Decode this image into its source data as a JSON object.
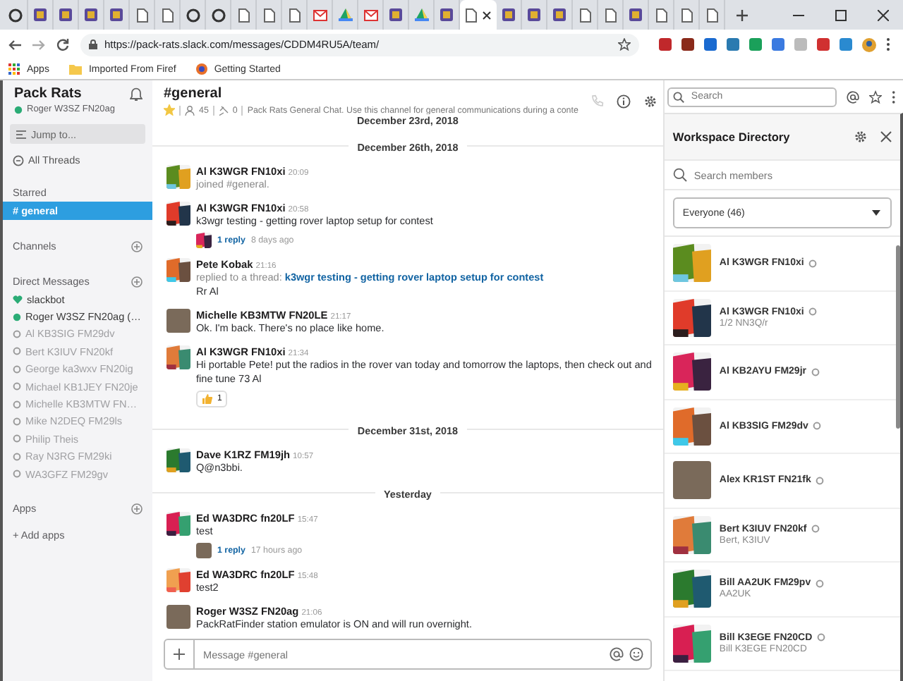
{
  "browser": {
    "tabs": [
      {
        "kind": "round",
        "selected": false
      },
      {
        "kind": "app",
        "selected": false
      },
      {
        "kind": "app",
        "selected": false
      },
      {
        "kind": "app",
        "selected": false
      },
      {
        "kind": "app",
        "selected": false
      },
      {
        "kind": "page",
        "selected": false
      },
      {
        "kind": "page",
        "selected": false
      },
      {
        "kind": "round",
        "selected": false
      },
      {
        "kind": "round",
        "selected": false
      },
      {
        "kind": "page",
        "selected": false
      },
      {
        "kind": "page",
        "selected": false
      },
      {
        "kind": "page",
        "selected": false
      },
      {
        "kind": "mail",
        "selected": false
      },
      {
        "kind": "drive",
        "selected": false
      },
      {
        "kind": "mail",
        "selected": false
      },
      {
        "kind": "app",
        "selected": false
      },
      {
        "kind": "drive",
        "selected": false
      },
      {
        "kind": "app",
        "selected": false
      },
      {
        "kind": "page",
        "selected": true
      },
      {
        "kind": "app",
        "selected": false
      },
      {
        "kind": "app",
        "selected": false
      },
      {
        "kind": "app",
        "selected": false
      },
      {
        "kind": "page",
        "selected": false
      },
      {
        "kind": "page",
        "selected": false
      },
      {
        "kind": "app",
        "selected": false
      },
      {
        "kind": "page",
        "selected": false
      },
      {
        "kind": "page",
        "selected": false
      },
      {
        "kind": "page",
        "selected": false
      }
    ],
    "url": "https://pack-rats.slack.com/messages/CDDM4RU5A/team/",
    "bookmarks": [
      "Apps",
      "Imported From Firef",
      "Getting Started"
    ]
  },
  "sidebar": {
    "workspace": "Pack Rats",
    "user": "Roger W3SZ FN20ag",
    "jump": "Jump to...",
    "all_threads": "All Threads",
    "sections": [
      {
        "title": "Starred",
        "add": false,
        "items": [
          {
            "label": "# general",
            "selected": true,
            "kind": "channel"
          }
        ]
      },
      {
        "title": "Channels",
        "add": true
      },
      {
        "title": "Direct Messages",
        "add": true,
        "items": [
          {
            "label": "slackbot",
            "kind": "bot",
            "online": true,
            "selected": false
          },
          {
            "label": "Roger W3SZ FN20ag (…",
            "kind": "person",
            "online": true,
            "selected": false
          },
          {
            "label": "Al KB3SIG FM29dv",
            "kind": "person",
            "online": false,
            "selected": false
          },
          {
            "label": "Bert K3IUV FN20kf",
            "kind": "person",
            "online": false,
            "selected": false
          },
          {
            "label": "George ka3wxv FN20ig",
            "kind": "person",
            "online": false,
            "selected": false
          },
          {
            "label": "Michael KB1JEY FN20je",
            "kind": "person",
            "online": false,
            "selected": false
          },
          {
            "label": "Michelle KB3MTW FN…",
            "kind": "person",
            "online": false,
            "selected": false
          },
          {
            "label": "Mike N2DEQ FM29ls",
            "kind": "person",
            "online": false,
            "selected": false
          },
          {
            "label": "Philip Theis",
            "kind": "person",
            "online": false,
            "selected": false
          },
          {
            "label": "Ray N3RG FM29ki",
            "kind": "person",
            "online": false,
            "selected": false
          },
          {
            "label": "WA3GFZ FM29gv",
            "kind": "person",
            "online": false,
            "selected": false
          }
        ]
      },
      {
        "title": "Apps",
        "add": true
      }
    ],
    "add_apps": "+ Add apps"
  },
  "channel": {
    "name": "#general",
    "starred": true,
    "members": "45",
    "pins": "0",
    "topic": "Pack Rats General Chat.  Use this channel for general communications during a conte"
  },
  "search": {
    "placeholder": "Search"
  },
  "messages": [
    {
      "kind": "date",
      "text": "December 23rd, 2018"
    },
    {
      "kind": "date",
      "text": "December 26th, 2018"
    },
    {
      "kind": "event",
      "author": "Al K3WGR FN10xi",
      "time": "20:09",
      "avatar": {
        "kind": "identicon"
      },
      "text": "joined #general."
    },
    {
      "kind": "message",
      "author": "Al K3WGR FN10xi",
      "time": "20:58",
      "avatar": {
        "kind": "identicon"
      },
      "text": "k3wgr testing - getting rover laptop setup for contest",
      "replies": {
        "count": "1 reply",
        "when": "8 days ago",
        "avatar": {
          "kind": "identicon"
        }
      }
    },
    {
      "kind": "message",
      "author": "Pete Kobak",
      "time": "21:16",
      "avatar": {
        "kind": "identicon"
      },
      "thread": {
        "prefix": "replied to a thread:",
        "link": "k3wgr testing - getting rover laptop setup for contest"
      },
      "text": "Rr Al"
    },
    {
      "kind": "message",
      "author": "Michelle KB3MTW FN20LE",
      "time": "21:17",
      "avatar": {
        "kind": "photo"
      },
      "text": "Ok. I'm back. There's no place like home."
    },
    {
      "kind": "message",
      "author": "Al K3WGR FN10xi",
      "time": "21:34",
      "avatar": {
        "kind": "identicon"
      },
      "text": "Hi portable Pete! put the radios in the rover van today and tomorrow the laptops, then check out and  fine tune 73  Al",
      "reaction": {
        "count": "1"
      }
    },
    {
      "kind": "date",
      "text": "December 31st, 2018"
    },
    {
      "kind": "message",
      "author": "Dave K1RZ FM19jh",
      "time": "10:57",
      "avatar": {
        "kind": "identicon"
      },
      "text": "Q@n3bbi."
    },
    {
      "kind": "date",
      "text": "Yesterday"
    },
    {
      "kind": "message",
      "author": "Ed WA3DRC fn20LF",
      "time": "15:47",
      "avatar": {
        "kind": "identicon"
      },
      "text": "test",
      "replies": {
        "count": "1 reply",
        "when": "17 hours ago",
        "avatar": {
          "kind": "photo"
        }
      }
    },
    {
      "kind": "message",
      "author": "Ed WA3DRC fn20LF",
      "time": "15:48",
      "avatar": {
        "kind": "identicon"
      },
      "text": "test2"
    },
    {
      "kind": "message",
      "author": "Roger W3SZ FN20ag",
      "time": "21:06",
      "avatar": {
        "kind": "photo"
      },
      "text": "PackRatFinder station emulator is ON and will run overnight."
    }
  ],
  "composer": {
    "placeholder": "Message #general"
  },
  "directory": {
    "title": "Workspace Directory",
    "search_placeholder": "Search members",
    "filter": "Everyone (46)",
    "members": [
      {
        "name": "Al K3WGR FN10xi",
        "avatar": {
          "kind": "identicon"
        },
        "online": false
      },
      {
        "name": "Al K3WGR FN10xi",
        "sub": "1/2 NN3Q/r",
        "avatar": {
          "kind": "identicon"
        },
        "online": false
      },
      {
        "name": "Al KB2AYU FM29jr",
        "avatar": {
          "kind": "identicon"
        },
        "online": false
      },
      {
        "name": "Al KB3SIG FM29dv",
        "avatar": {
          "kind": "identicon"
        },
        "online": false
      },
      {
        "name": "Alex KR1ST FN21fk",
        "avatar": {
          "kind": "photo"
        },
        "online": false
      },
      {
        "name": "Bert K3IUV FN20kf",
        "sub": "Bert, K3IUV",
        "avatar": {
          "kind": "identicon"
        },
        "online": false
      },
      {
        "name": "Bill AA2UK FM29pv",
        "sub": "AA2UK",
        "avatar": {
          "kind": "identicon"
        },
        "online": false
      },
      {
        "name": "Bill K3EGE FN20CD",
        "sub": "Bill K3EGE FN20CD",
        "avatar": {
          "kind": "identicon"
        },
        "online": false
      }
    ]
  }
}
